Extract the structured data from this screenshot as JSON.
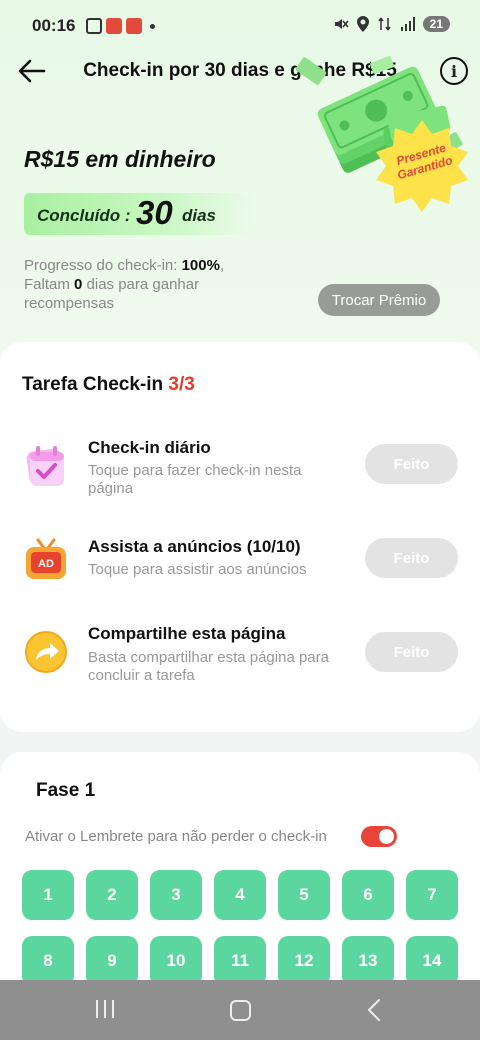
{
  "status_bar": {
    "time": "00:16",
    "battery": "21"
  },
  "header": {
    "title": "Check-in por 30 dias e ganhe R$15"
  },
  "hero": {
    "title": "R$15 em dinheiro",
    "completed_label": "Concluído :",
    "completed_days": "30",
    "completed_unit": "dias",
    "progress_prefix": "Progresso do check-in:",
    "progress_value": "100%",
    "progress_suffix": ",",
    "remaining_prefix": "Faltam",
    "remaining_value": "0",
    "remaining_suffix": "dias para ganhar recompensas",
    "badge_text": "Presente Garantido",
    "exchange_button": "Trocar Prêmio"
  },
  "tasks": {
    "title": "Tarefa Check-in",
    "count": "3/3",
    "items": [
      {
        "name": "Check-in diário",
        "desc": "Toque para fazer check-in nesta página",
        "button": "Feito",
        "icon": "calendar-check-icon"
      },
      {
        "name": "Assista a anúncios  (10/10)",
        "desc": "Toque para assistir aos anúncios",
        "button": "Feito",
        "icon": "tv-ad-icon"
      },
      {
        "name": "Compartilhe esta página",
        "desc": "Basta compartilhar esta página para concluir a tarefa",
        "button": "Feito",
        "icon": "share-arrow-icon"
      }
    ]
  },
  "phase": {
    "title": "Fase 1",
    "reminder_label": "Ativar o Lembrete para não perder o check-in",
    "reminder_enabled": true,
    "days": [
      "1",
      "2",
      "3",
      "4",
      "5",
      "6",
      "7",
      "8",
      "9",
      "10",
      "11",
      "12",
      "13",
      "14"
    ]
  },
  "colors": {
    "accent_red": "#e03c2c",
    "day_green": "#5bd69f",
    "done_gray": "#e3e3e3"
  }
}
